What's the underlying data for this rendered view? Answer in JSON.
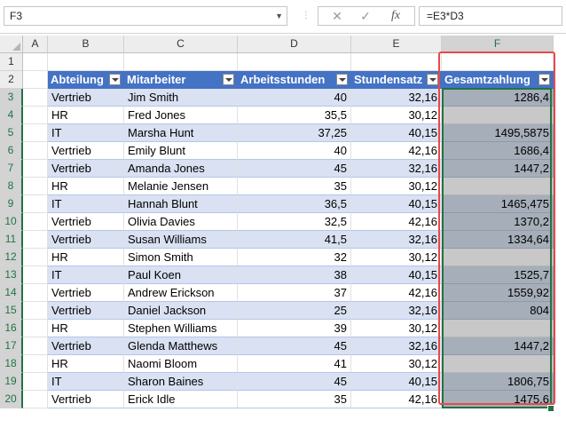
{
  "formula_bar": {
    "name_box": "F3",
    "formula": "=E3*D3",
    "cancel_icon": "cancel-icon",
    "enter_icon": "check-icon",
    "fx_label": "fx"
  },
  "columns": [
    "A",
    "B",
    "C",
    "D",
    "E",
    "F"
  ],
  "selected_column": "F",
  "rows": [
    "1",
    "2",
    "3",
    "4",
    "5",
    "6",
    "7",
    "8",
    "9",
    "10",
    "11",
    "12",
    "13",
    "14",
    "15",
    "16",
    "17",
    "18",
    "19",
    "20"
  ],
  "table": {
    "headers": [
      "Abteilung",
      "Mitarbeiter",
      "Arbeitsstunden",
      "Stundensatz",
      "Gesamtzahlung"
    ],
    "data": [
      [
        "Vertrieb",
        "Jim Smith",
        "40",
        "32,16",
        "1286,4"
      ],
      [
        "HR",
        "Fred Jones",
        "35,5",
        "30,12",
        ""
      ],
      [
        "IT",
        "Marsha Hunt",
        "37,25",
        "40,15",
        "1495,5875"
      ],
      [
        "Vertrieb",
        "Emily Blunt",
        "40",
        "42,16",
        "1686,4"
      ],
      [
        "Vertrieb",
        "Amanda Jones",
        "45",
        "32,16",
        "1447,2"
      ],
      [
        "HR",
        "Melanie Jensen",
        "35",
        "30,12",
        ""
      ],
      [
        "IT",
        "Hannah Blunt",
        "36,5",
        "40,15",
        "1465,475"
      ],
      [
        "Vertrieb",
        "Olivia Davies",
        "32,5",
        "42,16",
        "1370,2"
      ],
      [
        "Vertrieb",
        "Susan Williams",
        "41,5",
        "32,16",
        "1334,64"
      ],
      [
        "HR",
        "Simon Smith",
        "32",
        "30,12",
        ""
      ],
      [
        "IT",
        "Paul Koen",
        "38",
        "40,15",
        "1525,7"
      ],
      [
        "Vertrieb",
        "Andrew Erickson",
        "37",
        "42,16",
        "1559,92"
      ],
      [
        "Vertrieb",
        "Daniel Jackson",
        "25",
        "32,16",
        "804"
      ],
      [
        "HR",
        "Stephen Williams",
        "39",
        "30,12",
        ""
      ],
      [
        "Vertrieb",
        "Glenda Matthews",
        "45",
        "32,16",
        "1447,2"
      ],
      [
        "HR",
        "Naomi Bloom",
        "41",
        "30,12",
        ""
      ],
      [
        "IT",
        "Sharon Baines",
        "45",
        "40,15",
        "1806,75"
      ],
      [
        "Vertrieb",
        "Erick Idle",
        "35",
        "42,16",
        "1475,6"
      ]
    ]
  },
  "colors": {
    "header_blue": "#4472c4",
    "band_blue": "#d9e1f2",
    "excel_green": "#217346",
    "highlight_red": "#e84949"
  }
}
